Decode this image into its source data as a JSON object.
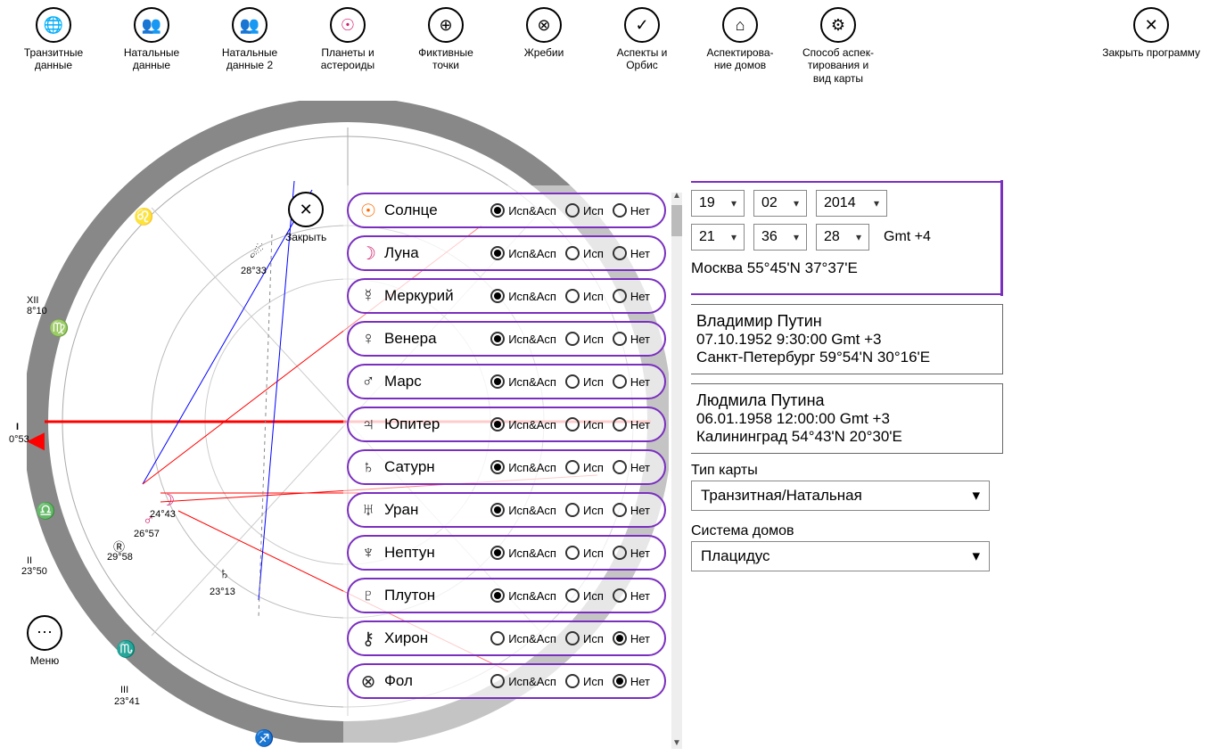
{
  "toolbar": {
    "items": [
      {
        "label": "Транзитные данные",
        "icon": "🌐"
      },
      {
        "label": "Натальные данные",
        "icon": "👥"
      },
      {
        "label": "Натальные данные 2",
        "icon": "👥"
      },
      {
        "label": "Планеты и астероиды",
        "icon": "☉"
      },
      {
        "label": "Фиктивные точки",
        "icon": "⊕"
      },
      {
        "label": "Жребии",
        "icon": "⊗"
      },
      {
        "label": "Аспекты и Орбис",
        "icon": "✓"
      },
      {
        "label": "Аспектирова­ние домов",
        "icon": "⌂"
      },
      {
        "label": "Способ аспек­тирования и вид карты",
        "icon": "⚙"
      }
    ],
    "close": {
      "label": "Закрыть программу",
      "icon": "✕"
    }
  },
  "close_popup_label": "Закрыть",
  "radio_labels": {
    "both": "Исп&Асп",
    "use": "Исп",
    "none": "Нет"
  },
  "planets": [
    {
      "glyph": "☉",
      "name": "Солнце",
      "color": "#ff6a00",
      "selected": "both"
    },
    {
      "glyph": "☽",
      "name": "Луна",
      "color": "#d31b6b",
      "selected": "both"
    },
    {
      "glyph": "☿",
      "name": "Меркурий",
      "color": "#222",
      "selected": "both"
    },
    {
      "glyph": "♀",
      "name": "Венера",
      "color": "#222",
      "selected": "both"
    },
    {
      "glyph": "♂",
      "name": "Марс",
      "color": "#222",
      "selected": "both"
    },
    {
      "glyph": "♃",
      "name": "Юпитер",
      "color": "#222",
      "selected": "both"
    },
    {
      "glyph": "♄",
      "name": "Сатурн",
      "color": "#222",
      "selected": "both"
    },
    {
      "glyph": "♅",
      "name": "Уран",
      "color": "#222",
      "selected": "both"
    },
    {
      "glyph": "♆",
      "name": "Нептун",
      "color": "#222",
      "selected": "both"
    },
    {
      "glyph": "♇",
      "name": "Плутон",
      "color": "#222",
      "selected": "both"
    },
    {
      "glyph": "⚷",
      "name": "Хирон",
      "color": "#222",
      "selected": "none"
    },
    {
      "glyph": "⊗",
      "name": "Фол",
      "color": "#222",
      "selected": "none"
    }
  ],
  "date": {
    "day": "19",
    "month": "02",
    "year": "2014"
  },
  "time": {
    "hour": "21",
    "min": "36",
    "sec": "28",
    "gmt": "Gmt +4"
  },
  "city": "Москва  55°45'N   37°37'E",
  "persons": [
    {
      "name": "Владимир Путин",
      "dt": "07.10.1952 9:30:00  Gmt +3",
      "loc": "Санкт-Петербург  59°54'N  30°16'E"
    },
    {
      "name": "Людмила Путина",
      "dt": "06.01.1958 12:00:00  Gmt +3",
      "loc": "Калининград  54°43'N  20°30'E"
    }
  ],
  "chart_type": {
    "label": "Тип карты",
    "value": "Транзитная/Натальная"
  },
  "house_system": {
    "label": "Система домов",
    "value": "Плацидус"
  },
  "menu_label": "Меню",
  "chart_labels": {
    "xii": "XII",
    "xii_deg": "8°10",
    "i": "I",
    "i_deg": "0°53",
    "ii": "II",
    "ii_deg": "23°50",
    "iii": "III",
    "iii_deg": "23°41",
    "mars_deg": "24°43",
    "moon2_deg": "26°57",
    "r_deg": "29°58",
    "chiron_deg": "28°33",
    "saturn_deg": "23°13"
  }
}
